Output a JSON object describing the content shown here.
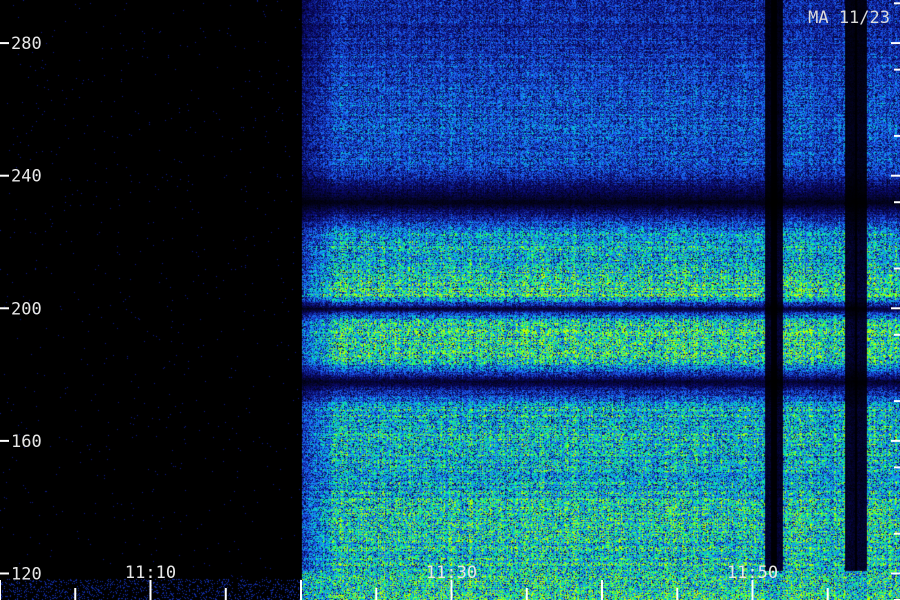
{
  "chart_data": {
    "type": "heatmap",
    "title": "MA 11/23",
    "y_ticks": [
      120,
      160,
      200,
      240,
      280
    ],
    "y_tick_labels": [
      "120",
      "160",
      "200",
      "240",
      "280"
    ],
    "y_range": [
      112,
      293
    ],
    "x_ticks": [
      "11:10",
      "11:30",
      "11:50"
    ],
    "x_ticks_minutes": [
      670,
      690,
      710
    ],
    "x_range_minutes": [
      660,
      719.8
    ],
    "data_start_minute": 680,
    "colors": {
      "background": "#000000",
      "low": "#0a0a6e",
      "mid": "#1e64ff",
      "high": "#00e6c8",
      "peak": "#3cff3c",
      "tick": "#ffffff"
    },
    "bands": [
      {
        "y": 284,
        "level": 0.35
      },
      {
        "y": 270,
        "level": 0.45
      },
      {
        "y": 255,
        "level": 0.5
      },
      {
        "y": 242,
        "level": 0.45
      },
      {
        "y": 232,
        "level": 0.05
      },
      {
        "y": 222,
        "level": 0.7
      },
      {
        "y": 212,
        "level": 0.75
      },
      {
        "y": 204,
        "level": 0.95
      },
      {
        "y": 200,
        "level": 0.1
      },
      {
        "y": 196,
        "level": 0.9
      },
      {
        "y": 185,
        "level": 0.9
      },
      {
        "y": 178,
        "level": 0.1
      },
      {
        "y": 170,
        "level": 0.75
      },
      {
        "y": 160,
        "level": 0.8
      },
      {
        "y": 150,
        "level": 0.7
      },
      {
        "y": 138,
        "level": 0.85
      },
      {
        "y": 126,
        "level": 0.8
      },
      {
        "y": 116,
        "level": 0.85
      }
    ],
    "dark_columns_minutes": [
      711.2,
      711.6,
      716.5,
      717.2
    ]
  }
}
